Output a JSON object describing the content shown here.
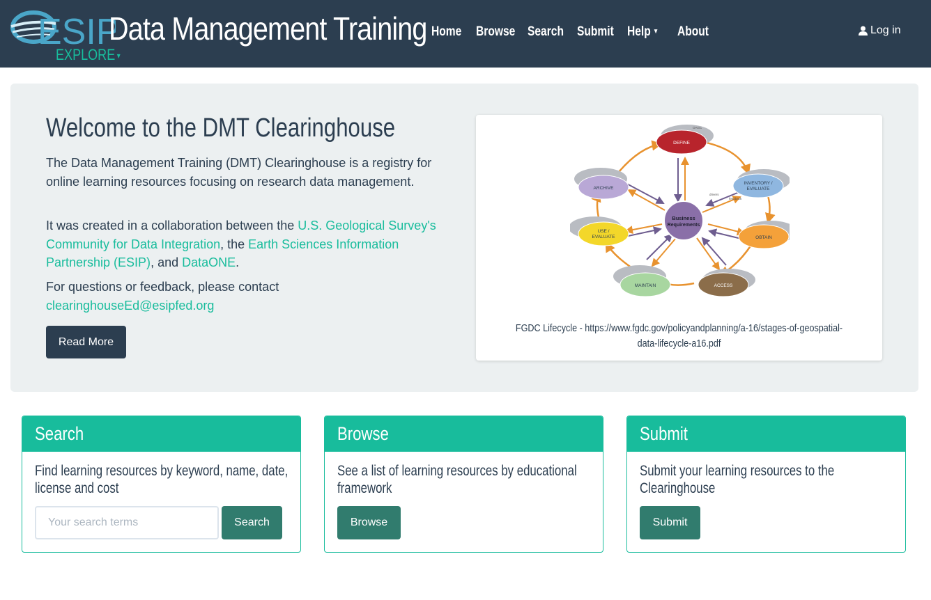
{
  "navbar": {
    "logo_text": "ESIP",
    "title": "Data Management Training",
    "explore_label": "EXPLORE",
    "items": [
      {
        "label": "Home"
      },
      {
        "label": "Browse"
      },
      {
        "label": "Search"
      },
      {
        "label": "Submit"
      },
      {
        "label": "Help"
      },
      {
        "label": "About"
      }
    ],
    "login_label": "Log in",
    "colors": {
      "background": "#2c3e50",
      "accent": "#18bc9c"
    }
  },
  "jumbotron": {
    "title": "Welcome to the DMT Clearinghouse",
    "intro": "The Data Management Training (DMT) Clearinghouse is a registry for online learning resources focusing on research data management.",
    "collab_prefix": "It was created in a collaboration between the ",
    "collab_link1": "U.S. Geological Survey's Community for Data Integration",
    "collab_mid": ", the ",
    "collab_link2": "Earth Sciences Information Partnership (ESIP)",
    "collab_and": ", and ",
    "collab_link3": "DataONE",
    "collab_end": ".",
    "contact_prefix": "For questions or feedback, please contact ",
    "contact_email": "clearinghouseEd@esipfed.org",
    "read_more_label": "Read More"
  },
  "figure": {
    "caption": "FGDC Lifecycle - https://www.fgdc.gov/policyandplanning/a-16/stages-of-geospatial-data-lifecycle-a16.pdf",
    "center_label_1": "Business",
    "center_label_2": "Requirements",
    "stages": {
      "define": "DEFINE",
      "inventory_1": "INVENTORY /",
      "inventory_2": "EVALUATE",
      "obtain": "OBTAIN",
      "access": "ACCESS",
      "maintain": "MAINTAIN",
      "use_1": "USE /",
      "use_2": "EVALUATE",
      "archive": "ARCHIVE"
    },
    "edge_labels": {
      "feedback": "feedback",
      "drivers": "drivers",
      "oagc": "OAGC"
    }
  },
  "panels": {
    "search": {
      "title": "Search",
      "text": "Find learning resources by keyword, name, date, license and cost",
      "placeholder": "Your search terms",
      "button": "Search"
    },
    "browse": {
      "title": "Browse",
      "text": "See a list of learning resources by educational framework",
      "button": "Browse"
    },
    "submit": {
      "title": "Submit",
      "text": "Submit your learning resources to the Clearinghouse",
      "button": "Submit"
    }
  }
}
